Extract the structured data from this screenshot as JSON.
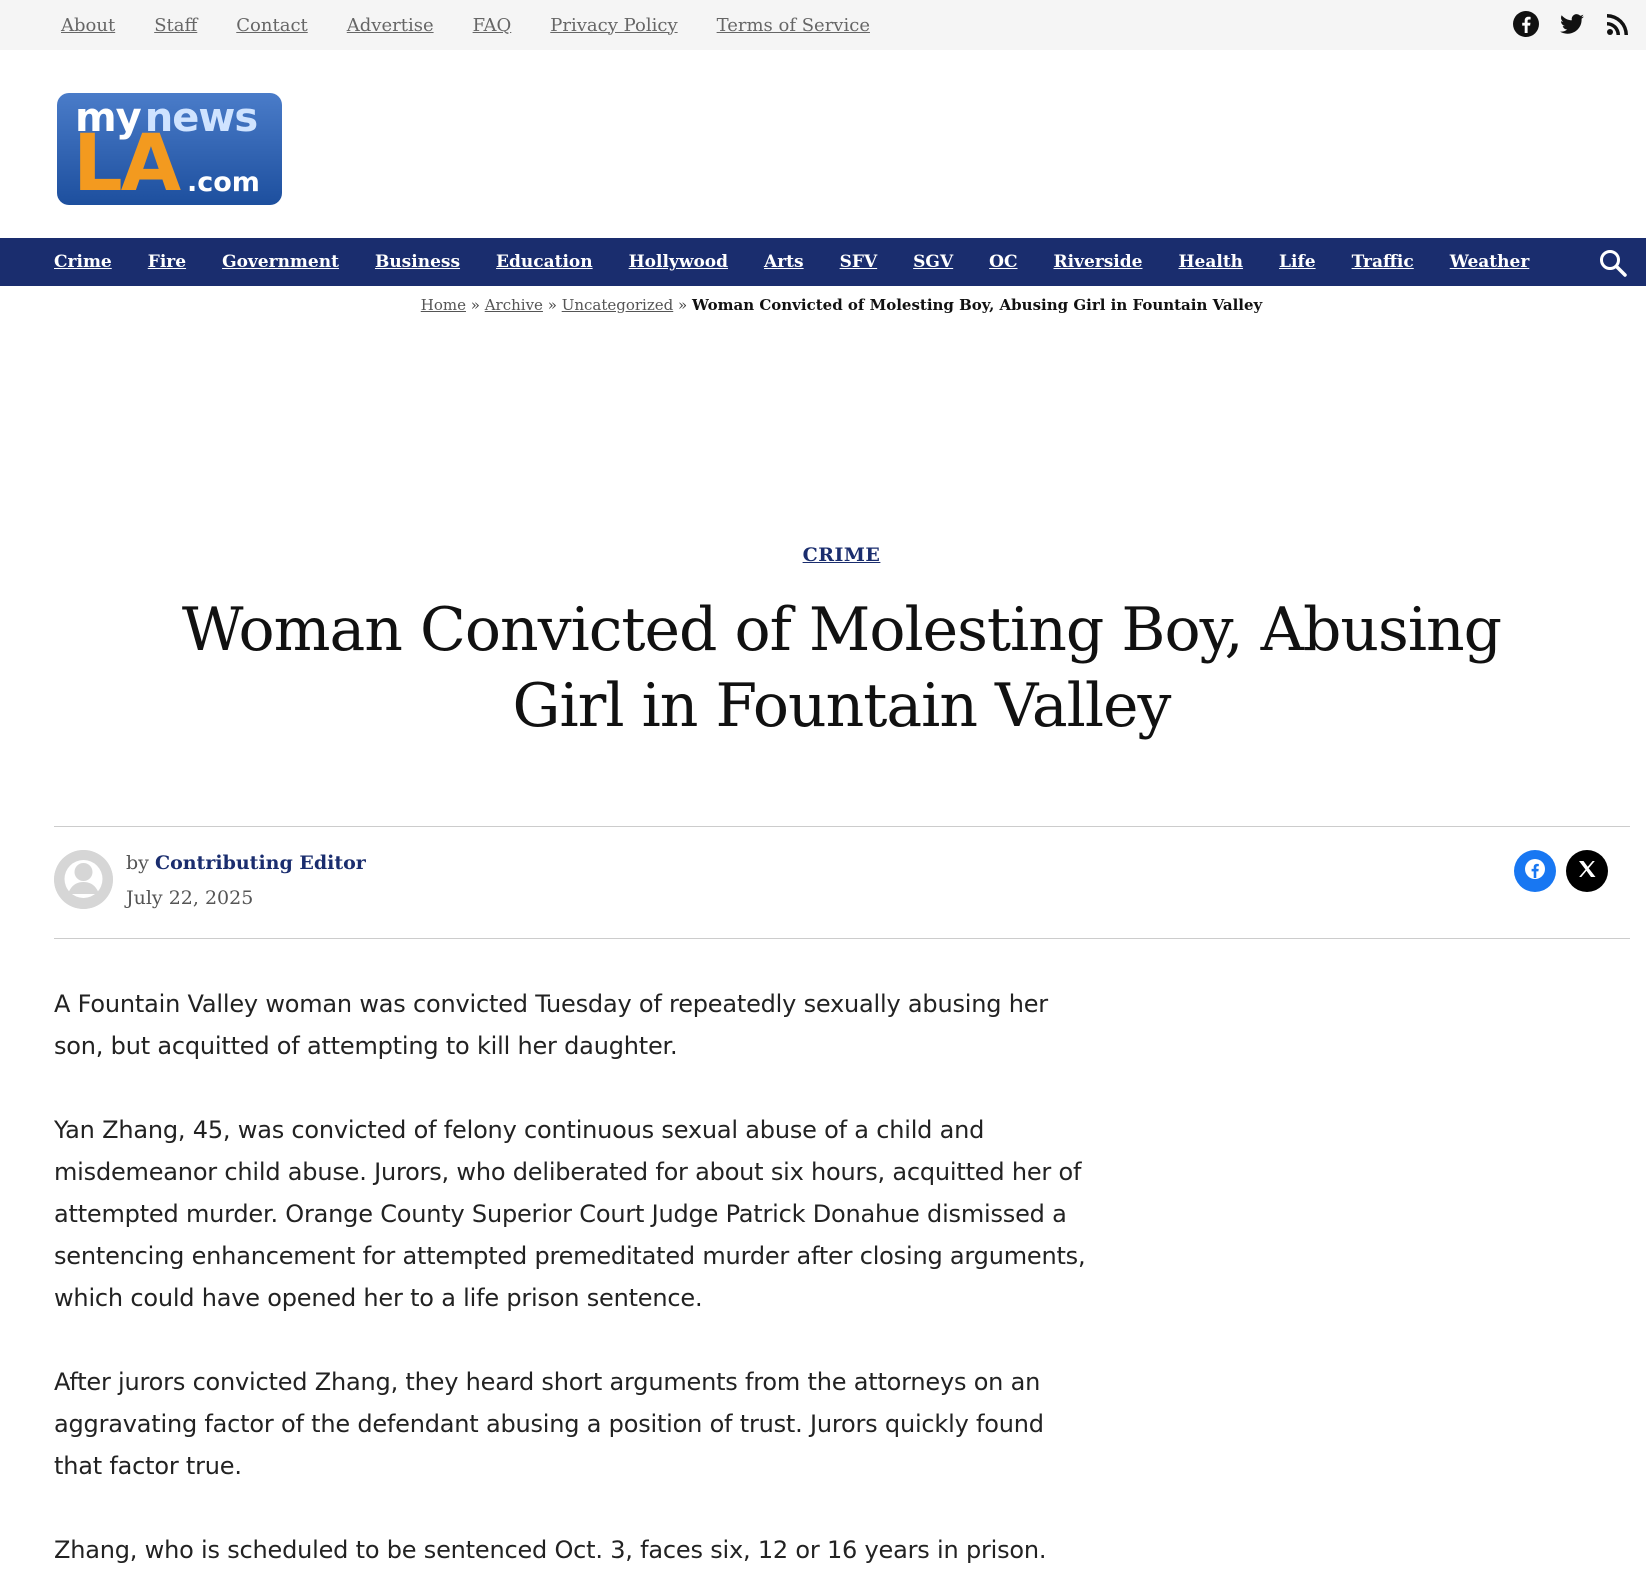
{
  "topbar": {
    "links": [
      "About",
      "Staff",
      "Contact",
      "Advertise",
      "FAQ",
      "Privacy Policy",
      "Terms of Service"
    ],
    "social_icons": [
      "facebook-icon",
      "twitter-icon",
      "rss-icon"
    ]
  },
  "logo": {
    "line1_a": "my",
    "line1_b": "news",
    "line2": "LA",
    "line3": ".com"
  },
  "nav": {
    "items": [
      "Crime",
      "Fire",
      "Government",
      "Business",
      "Education",
      "Hollywood",
      "Arts",
      "SFV",
      "SGV",
      "OC",
      "Riverside",
      "Health",
      "Life",
      "Traffic",
      "Weather"
    ],
    "search_icon": "search-icon"
  },
  "breadcrumb": {
    "items": [
      "Home",
      "Archive",
      "Uncategorized"
    ],
    "separator": "»",
    "current": "Woman Convicted of Molesting Boy, Abusing Girl in Fountain Valley"
  },
  "article": {
    "category": "CRIME",
    "title": "Woman Convicted of Molesting Boy, Abusing Girl in Fountain Valley",
    "by_prefix": "by",
    "author": "Contributing Editor",
    "date": "July 22, 2025",
    "paragraphs": [
      "A Fountain Valley woman was convicted Tuesday of repeatedly sexually abusing her son, but acquitted of attempting to kill her daughter.",
      "Yan Zhang, 45, was convicted of felony continuous sexual abuse of a child and misdemeanor child abuse. Jurors, who deliberated for about six hours, acquitted her of attempted murder. Orange County Superior Court Judge Patrick Donahue dismissed a sentencing enhancement for attempted premeditated murder after closing arguments, which could have opened her to a life prison sentence.",
      "After jurors convicted Zhang, they heard short arguments from the attorneys on an aggravating factor of the defendant abusing a position of trust. Jurors quickly found that factor true.",
      "Zhang, who is scheduled to be sentenced Oct. 3, faces six, 12 or 16 years in prison."
    ]
  },
  "colors": {
    "nav_background": "#1a2d6e",
    "topbar_background": "#f5f5f5",
    "facebook": "#1877f2",
    "x": "#000000",
    "logo_orange": "#f39a1f",
    "logo_blue": "#1d4f9e"
  }
}
